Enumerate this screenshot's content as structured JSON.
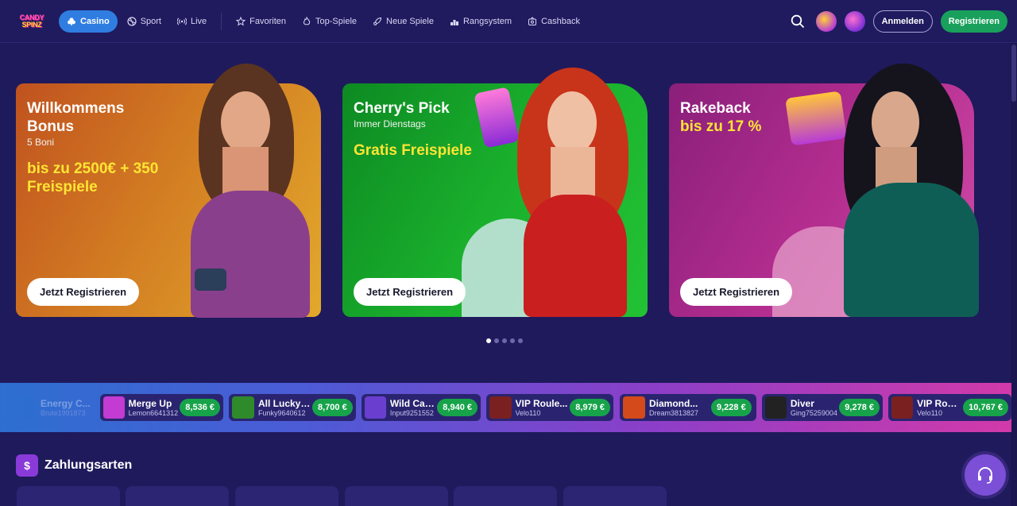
{
  "header": {
    "logo_line1": "CANDY",
    "logo_line2": "SPINZ",
    "nav": [
      {
        "label": "Casino",
        "icon": "club-icon",
        "active": true
      },
      {
        "label": "Sport",
        "icon": "ball-icon",
        "active": false
      },
      {
        "label": "Live",
        "icon": "broadcast-icon",
        "active": false
      },
      {
        "label": "Favoriten",
        "icon": "star-icon",
        "active": false
      },
      {
        "label": "Top-Spiele",
        "icon": "flame-icon",
        "active": false
      },
      {
        "label": "Neue Spiele",
        "icon": "rocket-icon",
        "active": false
      },
      {
        "label": "Rangsystem",
        "icon": "ranking-icon",
        "active": false
      },
      {
        "label": "Cashback",
        "icon": "cashback-icon",
        "active": false
      }
    ],
    "login_label": "Anmelden",
    "register_label": "Registrieren"
  },
  "banners": [
    {
      "title": "Willkommens Bonus",
      "subtitle": "5 Boni",
      "offer": "bis zu 2500€ + 350 Freispiele",
      "button": "Jetzt Registrieren"
    },
    {
      "title": "Cherry's Pick",
      "subtitle": "Immer Dienstags",
      "offer": "Gratis Freispiele",
      "button": "Jetzt Registrieren"
    },
    {
      "title": "Rakeback",
      "subtitle": "",
      "offer": "bis zu 17 %",
      "button": "Jetzt Registrieren"
    }
  ],
  "carousel": {
    "pages": 5,
    "active": 0
  },
  "ticker": [
    {
      "game": "Energy C...",
      "user": "Brute1991873",
      "amount": "",
      "faded": true,
      "color": "#2d6fd0"
    },
    {
      "game": "Merge Up",
      "user": "Lemon6641312",
      "amount": "8,536 €",
      "color": "#c23bd2"
    },
    {
      "game": "All Lucky ...",
      "user": "Funky9640612",
      "amount": "8,700 €",
      "color": "#2e8a2a"
    },
    {
      "game": "Wild Cash",
      "user": "Input9251552",
      "amount": "8,940 €",
      "color": "#6a3fd0"
    },
    {
      "game": "VIP Roule...",
      "user": "Velo110",
      "amount": "8,979 €",
      "color": "#7a2020"
    },
    {
      "game": "Diamond...",
      "user": "Dream3813827",
      "amount": "9,228 €",
      "color": "#d44a1a"
    },
    {
      "game": "Diver",
      "user": "Ging75259004",
      "amount": "9,278 €",
      "color": "#222222"
    },
    {
      "game": "VIP Roul...",
      "user": "Velo110",
      "amount": "10,767 €",
      "color": "#7a2020"
    }
  ],
  "payments": {
    "title": "Zahlungsarten",
    "cards": 6
  },
  "colors": {
    "bg": "#1f1a5c",
    "accent": "#2f7de1",
    "register": "#19a05c",
    "offer": "#ffe534",
    "win": "#17a34a"
  }
}
